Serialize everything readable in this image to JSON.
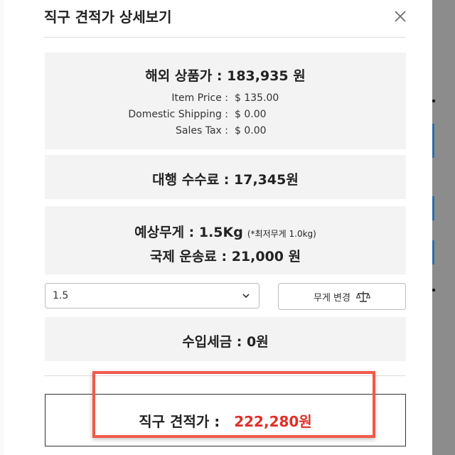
{
  "modal": {
    "title": "직구 견적가 상세보기",
    "close_icon": "close-icon"
  },
  "overseas": {
    "heading": "해외 상품가 : 183,935 원",
    "rows": [
      {
        "label": "Item Price :",
        "value": "$ 135.00"
      },
      {
        "label": "Domestic Shipping :",
        "value": "$ 0.00"
      },
      {
        "label": "Sales Tax :",
        "value": "$ 0.00"
      }
    ]
  },
  "agency_fee": "대행 수수료 : 17,345원",
  "weight": {
    "expected": "예상무게 : 1.5Kg",
    "min_note": "(*최저무게 1.0kg)",
    "intl_shipping": "국제 운송료 : 21,000 원"
  },
  "controls": {
    "weight_select_value": "1.5",
    "select_icon": "chevron-down-icon",
    "weight_change_label": "무게 변경",
    "weight_change_icon": "scale-icon"
  },
  "import_tax": "수입세금 : 0원",
  "total": {
    "label": "직구 견적가 :",
    "value": "222,280원"
  },
  "colors": {
    "accent_red": "#e0302a",
    "highlight": "#f05a4a",
    "card_bg": "#f3f3f3"
  }
}
